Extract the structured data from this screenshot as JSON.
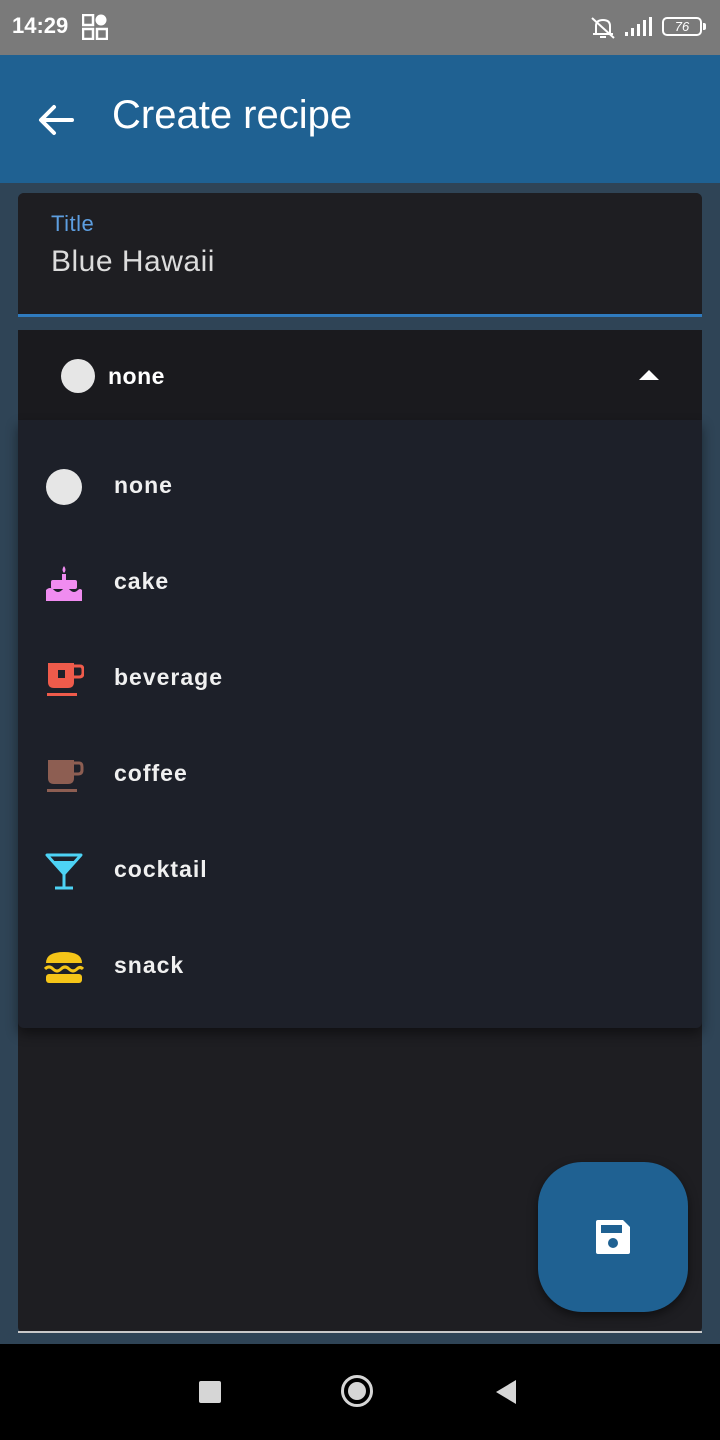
{
  "status_bar": {
    "time": "14:29",
    "battery": "76",
    "icons": [
      "apps-grid-icon",
      "bell-off-icon",
      "signal-icon",
      "battery-icon"
    ]
  },
  "app_bar": {
    "title": "Create recipe",
    "back_icon": "arrow-back-icon"
  },
  "form": {
    "title_label": "Title",
    "title_value": "Blue Hawaii",
    "category_selected": "none"
  },
  "menu": {
    "items": [
      {
        "label": "none",
        "icon": "circle-icon",
        "color": "#e6e6e6"
      },
      {
        "label": "cake",
        "icon": "cake-icon",
        "color": "#f08cf0"
      },
      {
        "label": "beverage",
        "icon": "tea-cup-icon",
        "color": "#ef5b4b"
      },
      {
        "label": "coffee",
        "icon": "coffee-cup-icon",
        "color": "#8d5e52"
      },
      {
        "label": "cocktail",
        "icon": "cocktail-glass-icon",
        "color": "#4dd3f5"
      },
      {
        "label": "snack",
        "icon": "burger-icon",
        "color": "#f5c518"
      }
    ]
  },
  "fab": {
    "icon": "save-icon"
  },
  "colors": {
    "accent": "#1f6192",
    "underline": "#2f7bbf",
    "label": "#5d9ee0",
    "surface": "#1e1e22",
    "menu_surface": "#1d2029",
    "background": "#2f4456"
  }
}
